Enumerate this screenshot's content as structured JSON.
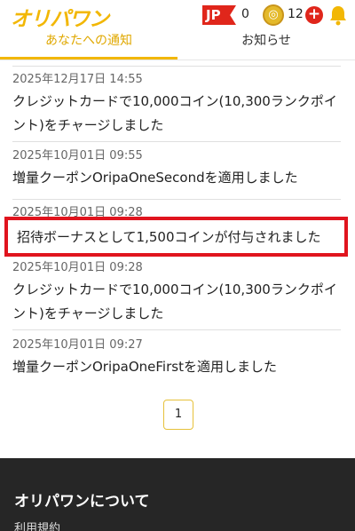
{
  "header": {
    "logo": "オリパワン",
    "region": "JP",
    "first_count": "0",
    "coin_count": "12",
    "colors": {
      "brand": "#f2b705",
      "red": "#e0261b"
    }
  },
  "tabs": [
    {
      "label": "あなたへの通知",
      "active": true
    },
    {
      "label": "お知らせ",
      "active": false
    }
  ],
  "notifications": [
    {
      "date": "2025年12月17日 14:55",
      "text": "クレジットカードで10,000コイン(10,300ランクポイント)をチャージしました"
    },
    {
      "date": "2025年10月01日 09:55",
      "text": "増量クーポンOripaOneSecondを適用しました"
    },
    {
      "date": "2025年10月01日 09:28",
      "text": "招待ボーナスとして1,500コインが付与されました",
      "highlighted": true
    },
    {
      "date": "2025年10月01日 09:28",
      "text": "クレジットカードで10,000コイン(10,300ランクポイント)をチャージしました"
    },
    {
      "date": "2025年10月01日 09:27",
      "text": "増量クーポンOripaOneFirstを適用しました"
    }
  ],
  "pagination": {
    "current": "1"
  },
  "footer": {
    "title": "オリパワンについて",
    "link": "利用規約"
  }
}
